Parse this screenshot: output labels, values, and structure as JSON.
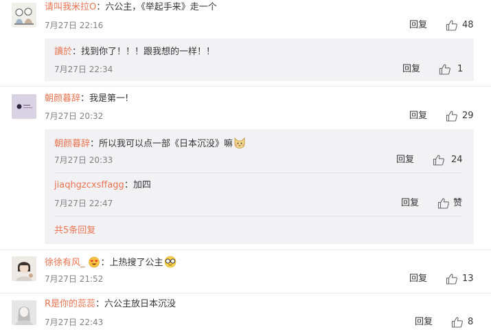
{
  "comments": [
    {
      "user": "请叫我米拉O",
      "text": "：六公主，《举起手来》走一个",
      "time": "7月27日 22:16",
      "reply_label": "回复",
      "likes": "48",
      "replies": [
        {
          "user": "讀於",
          "text": "：找到你了！！！跟我想的一样！！",
          "time": "7月27日 22:34",
          "reply_label": "回复",
          "likes": "1"
        }
      ]
    },
    {
      "user": "朝颜暮辞",
      "text": "：我是第一!",
      "time": "7月27日 20:32",
      "reply_label": "回复",
      "likes": "29",
      "replies": [
        {
          "user": "朝颜暮辞",
          "text": "：所以我可以点一部《日本沉没》嘛",
          "time": "7月27日 20:33",
          "reply_label": "回复",
          "likes": "24"
        },
        {
          "user": "jiaqhgzcxsffagg",
          "text": "：加四",
          "time": "7月27日 22:47",
          "reply_label": "回复",
          "likes": "赞"
        }
      ],
      "more_replies": "共5条回复"
    },
    {
      "user": "徐徐有风_",
      "text": "：上热搜了公主",
      "time": "7月27日 21:52",
      "reply_label": "回复",
      "likes": "13"
    },
    {
      "user": "R是你的蕊蕊",
      "text": "：六公主放日本沉没",
      "time": "7月27日 22:43",
      "reply_label": "回复",
      "likes": "8"
    }
  ],
  "icons": {
    "like": "thumbs-up-icon",
    "emoji_fox": "fox-face-emoji-icon",
    "emoji_heart_eyes": "heart-eyes-emoji-icon",
    "emoji_glasses": "glasses-emoji-icon"
  },
  "colors": {
    "username": "#eb7350",
    "subbox_bg": "#f2f2f5",
    "meta": "#808080"
  }
}
